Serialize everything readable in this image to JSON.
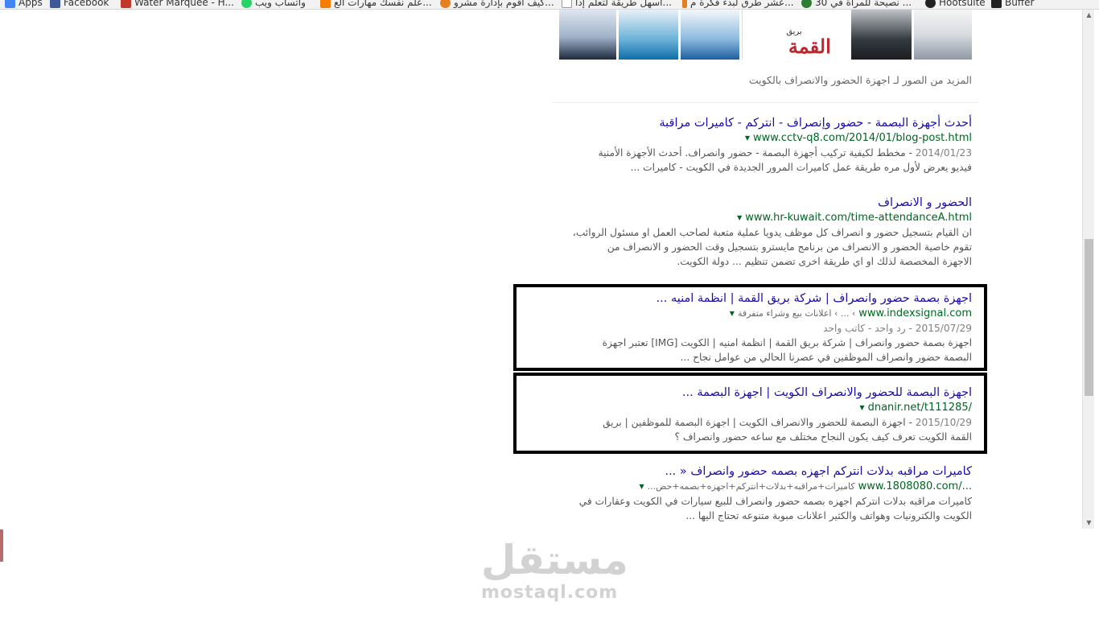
{
  "bookmarks": [
    {
      "label": "Apps",
      "icon": "apps-grid-icon",
      "color": "#4285f4"
    },
    {
      "label": "Facebook",
      "icon": "facebook-icon",
      "color": "#3b5998"
    },
    {
      "label": "Water Marquee - H...",
      "icon": "water-marquee-icon",
      "color": "#c0392b"
    },
    {
      "label": "واتساب ويب",
      "icon": "whatsapp-icon",
      "color": "#25d366"
    },
    {
      "label": "علم نفسك مهارات الع...",
      "icon": "blogger-icon",
      "color": "#f57d00"
    },
    {
      "label": "كيف اقوم بإدارة مشرو...",
      "icon": "network-icon",
      "color": "#e67e22"
    },
    {
      "label": "أسهل طريقة لتعلم إدا...",
      "icon": "page-icon",
      "color": "#999999"
    },
    {
      "label": "عشر طرق لبدء فكرة م...",
      "icon": "pen-icon",
      "color": "#e67e22"
    },
    {
      "label": "30 نصيحة للمرأة في ...",
      "icon": "globe-icon",
      "color": "#2e7d32"
    },
    {
      "label": "Hootsuite",
      "icon": "hootsuite-icon",
      "color": "#222222"
    },
    {
      "label": "Buffer",
      "icon": "buffer-icon",
      "color": "#222222"
    }
  ],
  "images": {
    "brand_logo": "القمة",
    "brand_small": "بريق",
    "more_link": "المزيد من الصور لـ اجهزة الحضور والانصراف بالكويت"
  },
  "results": [
    {
      "title": "أحدث أجهزة البصمة - حضور وإنصراف - انتركم - كاميرات مراقبة",
      "url": "www.cctv-q8.com/2014/01/blog-post.html",
      "breadcrumb": "",
      "line1_date": "2014/01/23",
      "line1_text": " - مخطط لكيفية تركيب أجهزة البصمة - حضور وانصراف. أحدث الأجهزة الأمنية",
      "line2_text": "فيديو يعرض لأول مره طريقة عمل كاميرات المرور الجديدة في الكويت - كاميرات ...",
      "line3_text": "",
      "line4_text": ""
    },
    {
      "title": "الحضور و الانصراف",
      "url": "www.hr-kuwait.com/time-attendanceA.html",
      "breadcrumb": "",
      "line1_date": "",
      "line1_text": "ان القيام بتسجيل حضور و انصراف كل موظف يدويا عملية متعبة لصاحب العمل او مسئول الروائب،",
      "line2_text": "تقوم خاصية الحضور و الانصراف من برنامج مايسترو بتسجيل وقت الحضور و الانصراف من",
      "line3_text": "الاجهزة المخصصة لذلك او اي طريقة اخرى تضمن تنظيم ... دولة الكويت.",
      "line4_text": ""
    },
    {
      "title": "اجهزة بصمة حضور وانصراف | شركة بريق القمة | انظمة امنيه ...",
      "url": "www.indexsignal.com",
      "breadcrumb": "› ... › اعلانات بيع وشراء متفرقة",
      "line1_date": "",
      "line1_text": "2015/07/29 - رد واحد - كاتب واحد",
      "line2_text": "اجهزة بصمة حضور وانصراف | شركة بريق القمة | انظمة امنيه | الكويت [IMG] تعتبر اجهزة",
      "line3_text": "البصمة حضور وانصراف الموظفين في عصرنا الحالي من عوامل نجاح ...",
      "line4_text": ""
    },
    {
      "title": "اجهزة البصمة للحضور والانصراف الكويت | اجهزة البصمة ...",
      "url": "dnanir.net/t111285/",
      "breadcrumb": "",
      "line1_date": "2015/10/29",
      "line1_text": " - اجهزة البصمة للحضور والانصراف الكويت | اجهزة البصمة للموظفين | بريق",
      "line2_text": "القمة الكويت تعرف كيف يكون النجاح مختلف مع ساعه حضور وانصراف ؟",
      "line3_text": "",
      "line4_text": ""
    },
    {
      "title": "كاميرات مراقبه بدلات انتركم اجهزه بصمه حضور وانصراف « ...",
      "url": "www.1808080.com/...",
      "breadcrumb": "كاميرات+مراقبه+بدلات+انتركم+اجهزه+بصمه+حض...",
      "line1_date": "",
      "line1_text": "كاميرات مراقبه بدلات انتركم اجهزه بصمه حضور وانصراف للبيع سيارات في الكويت وعقارات في",
      "line2_text": "الكويت والكترونيات وهواتف والكثير اعلانات مبوبة متنوعه تحتاج اليها ...",
      "line3_text": "",
      "line4_text": ""
    }
  ],
  "watermark": {
    "arabic": "مستقل",
    "latin": "mostaql.com"
  },
  "colors": {
    "title_link": "#1a0dab",
    "url_green": "#006621",
    "snippet": "#545454",
    "highlight_border": "#000000"
  }
}
